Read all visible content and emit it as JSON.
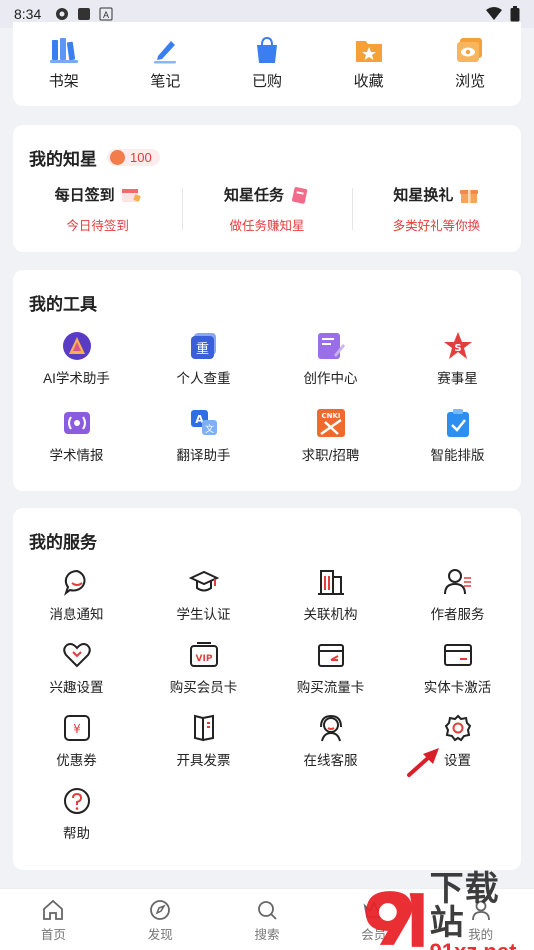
{
  "status_bar": {
    "time": "8:34"
  },
  "quick_links": [
    {
      "label": "书架",
      "icon": "bookshelf-icon"
    },
    {
      "label": "笔记",
      "icon": "note-pen-icon"
    },
    {
      "label": "已购",
      "icon": "shopping-bag-icon"
    },
    {
      "label": "收藏",
      "icon": "star-folder-icon"
    },
    {
      "label": "浏览",
      "icon": "eye-icon"
    }
  ],
  "stars": {
    "title": "我的知星",
    "count": "100",
    "items": [
      {
        "name": "每日签到",
        "sub": "今日待签到",
        "icon": "calendar-icon"
      },
      {
        "name": "知星任务",
        "sub": "做任务赚知星",
        "icon": "task-gift-icon"
      },
      {
        "name": "知星换礼",
        "sub": "多类好礼等你换",
        "icon": "gift-box-icon"
      }
    ]
  },
  "tools": {
    "title": "我的工具",
    "items": [
      {
        "label": "AI学术助手",
        "icon": "ai-assistant-icon"
      },
      {
        "label": "个人查重",
        "icon": "plagiarism-check-icon"
      },
      {
        "label": "创作中心",
        "icon": "creation-center-icon"
      },
      {
        "label": "赛事星",
        "icon": "contest-star-icon"
      },
      {
        "label": "学术情报",
        "icon": "academic-news-icon"
      },
      {
        "label": "翻译助手",
        "icon": "translate-icon"
      },
      {
        "label": "求职/招聘",
        "icon": "cnki-job-icon"
      },
      {
        "label": "智能排版",
        "icon": "smart-layout-icon"
      }
    ]
  },
  "services": {
    "title": "我的服务",
    "items": [
      {
        "label": "消息通知",
        "icon": "message-bubble-icon"
      },
      {
        "label": "学生认证",
        "icon": "graduation-cap-icon"
      },
      {
        "label": "关联机构",
        "icon": "institution-building-icon"
      },
      {
        "label": "作者服务",
        "icon": "author-icon"
      },
      {
        "label": "兴趣设置",
        "icon": "heart-icon"
      },
      {
        "label": "购买会员卡",
        "icon": "vip-card-icon"
      },
      {
        "label": "购买流量卡",
        "icon": "data-card-icon"
      },
      {
        "label": "实体卡激活",
        "icon": "physical-card-icon"
      },
      {
        "label": "优惠券",
        "icon": "coupon-icon"
      },
      {
        "label": "开具发票",
        "icon": "invoice-icon"
      },
      {
        "label": "在线客服",
        "icon": "customer-service-icon"
      },
      {
        "label": "设置",
        "icon": "gear-icon"
      },
      {
        "label": "帮助",
        "icon": "help-icon"
      }
    ]
  },
  "tabbar": [
    {
      "label": "首页",
      "icon": "home-icon"
    },
    {
      "label": "发现",
      "icon": "compass-icon"
    },
    {
      "label": "搜索",
      "icon": "search-icon"
    },
    {
      "label": "会员",
      "icon": "crown-icon"
    },
    {
      "label": "我的",
      "icon": "user-icon"
    }
  ],
  "watermark": {
    "big": "下载站",
    "small": "91xz.net"
  },
  "colors": {
    "accent": "#e53c3c",
    "blue": "#3a7ff0",
    "background": "#f1f2f6"
  }
}
